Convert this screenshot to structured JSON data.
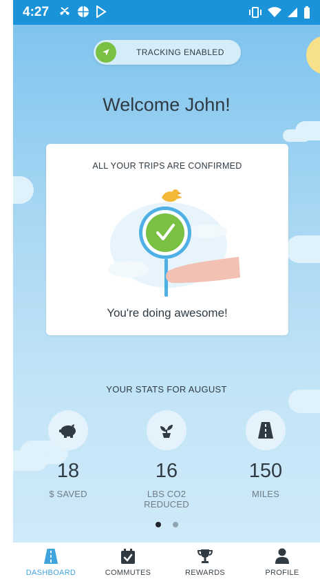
{
  "status_bar": {
    "time": "4:27"
  },
  "tracking": {
    "label": "TRACKING ENABLED"
  },
  "welcome": "Welcome John!",
  "trips_card": {
    "title": "ALL YOUR TRIPS ARE CONFIRMED",
    "message": "You're doing awesome!"
  },
  "stats": {
    "title": "YOUR STATS FOR AUGUST",
    "items": [
      {
        "value": "18",
        "label": "$ SAVED",
        "icon": "piggy-bank-icon"
      },
      {
        "value": "16",
        "label": "LBS CO2 REDUCED",
        "icon": "plant-icon"
      },
      {
        "value": "150",
        "label": "MILES",
        "icon": "road-icon"
      }
    ]
  },
  "pager": {
    "count": 2,
    "active": 0
  },
  "tabs": [
    {
      "label": "DASHBOARD",
      "icon": "road-icon",
      "active": true
    },
    {
      "label": "COMMUTES",
      "icon": "calendar-check-icon",
      "active": false
    },
    {
      "label": "REWARDS",
      "icon": "trophy-icon",
      "active": false
    },
    {
      "label": "PROFILE",
      "icon": "person-icon",
      "active": false
    }
  ],
  "colors": {
    "status_bar": "#1a93d9",
    "accent": "#3fa3dc",
    "success": "#7ac143",
    "text": "#2f3a43"
  }
}
